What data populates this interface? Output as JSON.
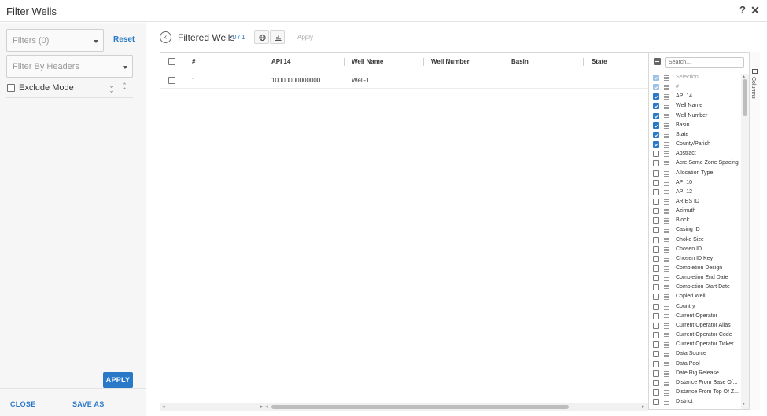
{
  "dialog": {
    "title": "Filter Wells",
    "help_icon": "question-icon",
    "close_icon": "close-icon"
  },
  "left": {
    "filters_placeholder": "Filters (0)",
    "reset_label": "Reset",
    "headers_placeholder": "Filter By Headers",
    "exclude_label": "Exclude Mode",
    "close_label": "CLOSE",
    "save_as_label": "SAVE AS",
    "apply_label": "APPLY"
  },
  "main": {
    "title": "Filtered Wells",
    "count": "0 / 1",
    "apply_label": "Apply"
  },
  "grid": {
    "columns": [
      "#",
      "API 14",
      "Well Name",
      "Well Number",
      "Basin",
      "State"
    ],
    "rows": [
      {
        "num": "1",
        "api14": "10000000000000",
        "well_name": "Well-1",
        "well_number": "",
        "basin": "",
        "state": ""
      }
    ]
  },
  "columns_panel": {
    "search_placeholder": "Search...",
    "tab_label": "Columns",
    "items": [
      {
        "label": "Selection",
        "state": "dim"
      },
      {
        "label": "#",
        "state": "dim"
      },
      {
        "label": "API 14",
        "state": "on"
      },
      {
        "label": "Well Name",
        "state": "on"
      },
      {
        "label": "Well Number",
        "state": "on"
      },
      {
        "label": "Basin",
        "state": "on"
      },
      {
        "label": "State",
        "state": "on"
      },
      {
        "label": "County/Parish",
        "state": "on"
      },
      {
        "label": "Abstract",
        "state": "off"
      },
      {
        "label": "Acre Same Zone Spacing",
        "state": "off"
      },
      {
        "label": "Allocation Type",
        "state": "off"
      },
      {
        "label": "API 10",
        "state": "off"
      },
      {
        "label": "API 12",
        "state": "off"
      },
      {
        "label": "ARIES ID",
        "state": "off"
      },
      {
        "label": "Azimuth",
        "state": "off"
      },
      {
        "label": "Block",
        "state": "off"
      },
      {
        "label": "Casing ID",
        "state": "off"
      },
      {
        "label": "Choke Size",
        "state": "off"
      },
      {
        "label": "Chosen ID",
        "state": "off"
      },
      {
        "label": "Chosen ID Key",
        "state": "off"
      },
      {
        "label": "Completion Design",
        "state": "off"
      },
      {
        "label": "Completion End Date",
        "state": "off"
      },
      {
        "label": "Completion Start Date",
        "state": "off"
      },
      {
        "label": "Copied Well",
        "state": "off"
      },
      {
        "label": "Country",
        "state": "off"
      },
      {
        "label": "Current Operator",
        "state": "off"
      },
      {
        "label": "Current Operator Alias",
        "state": "off"
      },
      {
        "label": "Current Operator Code",
        "state": "off"
      },
      {
        "label": "Current Operator Ticker",
        "state": "off"
      },
      {
        "label": "Data Source",
        "state": "off"
      },
      {
        "label": "Data Pool",
        "state": "off"
      },
      {
        "label": "Date Rig Release",
        "state": "off"
      },
      {
        "label": "Distance From Base Of...",
        "state": "off"
      },
      {
        "label": "Distance From Top Of Z...",
        "state": "off"
      },
      {
        "label": "District",
        "state": "off"
      }
    ]
  }
}
